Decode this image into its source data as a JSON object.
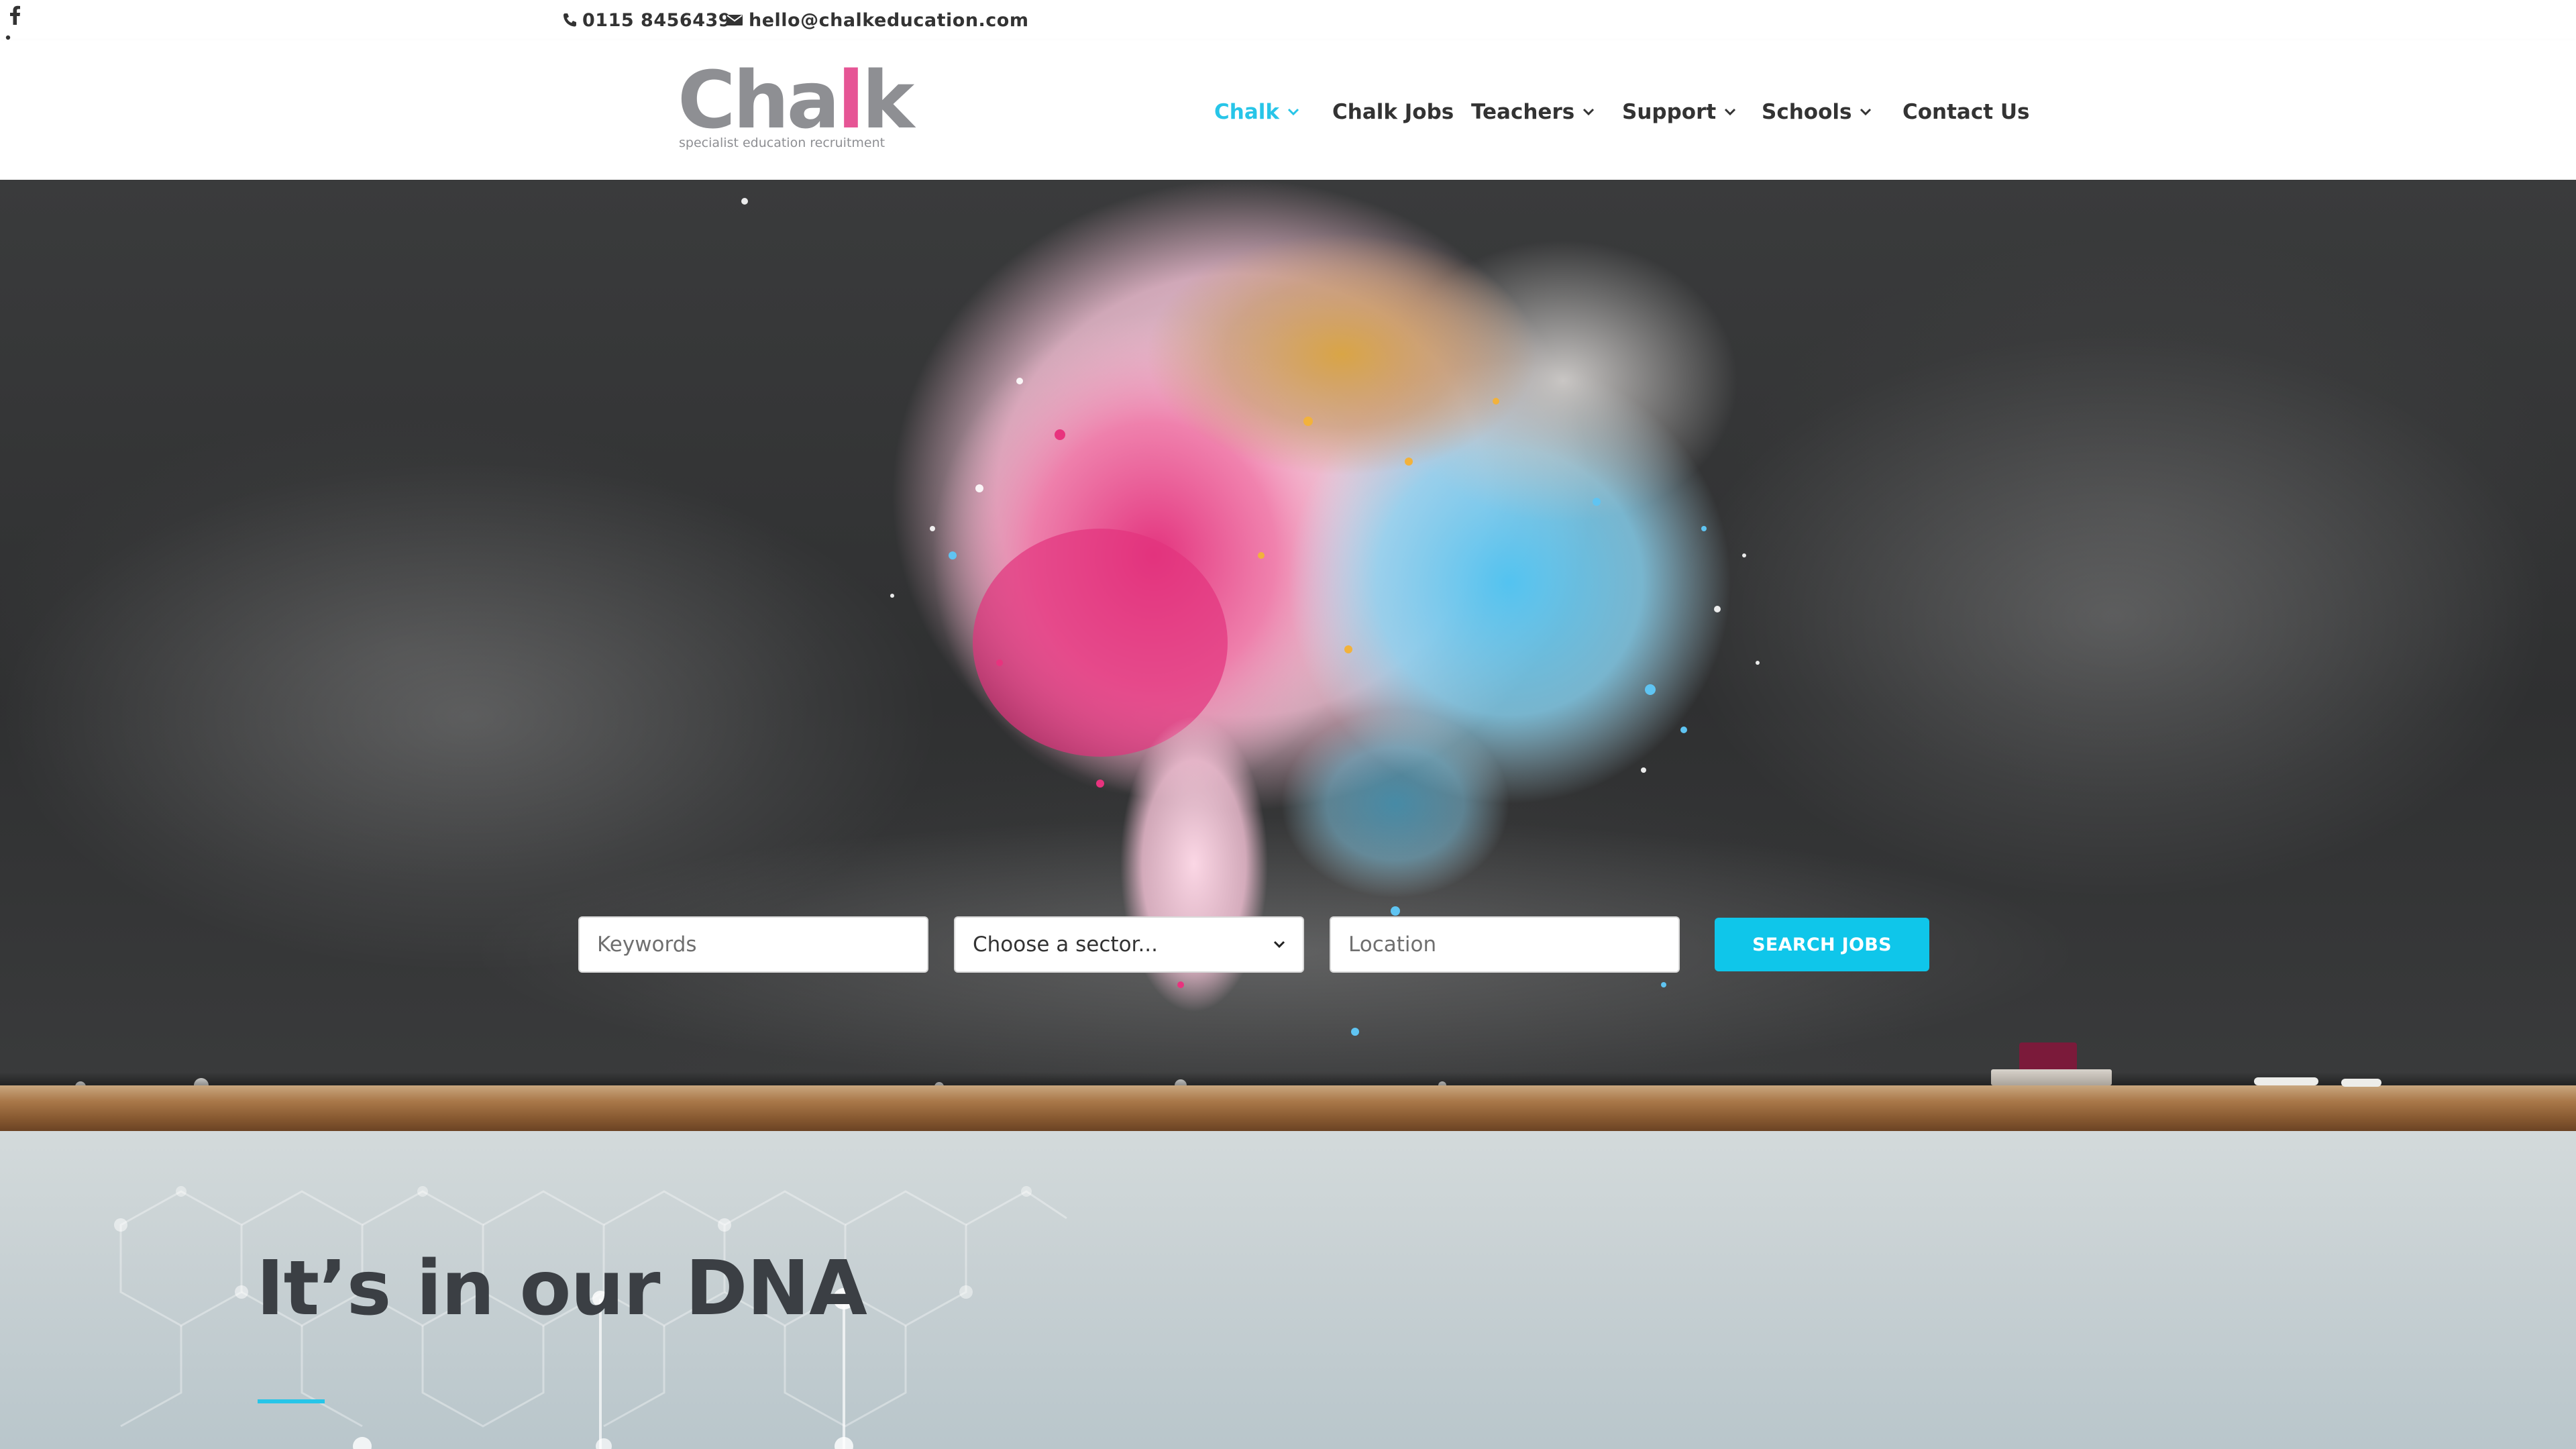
{
  "topbar": {
    "phone": "0115 8456439",
    "email": "hello@chalkeducation.com",
    "social": [
      "facebook-icon",
      "linkedin-icon"
    ]
  },
  "header": {
    "logo": {
      "wordmark_start": "Cha",
      "wordmark_accent": "l",
      "wordmark_end": "k",
      "tagline": "specialist education recruitment"
    },
    "nav": [
      {
        "label": "Chalk",
        "active": true,
        "dropdown": true
      },
      {
        "label": "Chalk Jobs",
        "active": false,
        "dropdown": false
      },
      {
        "label": "Teachers",
        "active": false,
        "dropdown": true
      },
      {
        "label": "Support",
        "active": false,
        "dropdown": true
      },
      {
        "label": "Schools",
        "active": false,
        "dropdown": true
      },
      {
        "label": "Contact Us",
        "active": false,
        "dropdown": false
      }
    ]
  },
  "search": {
    "keywords_placeholder": "Keywords",
    "sector_selected": "Choose a sector...",
    "location_placeholder": "Location",
    "button_label": "SEARCH JOBS"
  },
  "dna_section": {
    "heading": "It’s in our DNA"
  },
  "colors": {
    "accent": "#27c5e8",
    "button": "#0fc6ea",
    "brand_pink": "#e65595",
    "text_dark": "#333333",
    "chalkboard": "#333435"
  }
}
